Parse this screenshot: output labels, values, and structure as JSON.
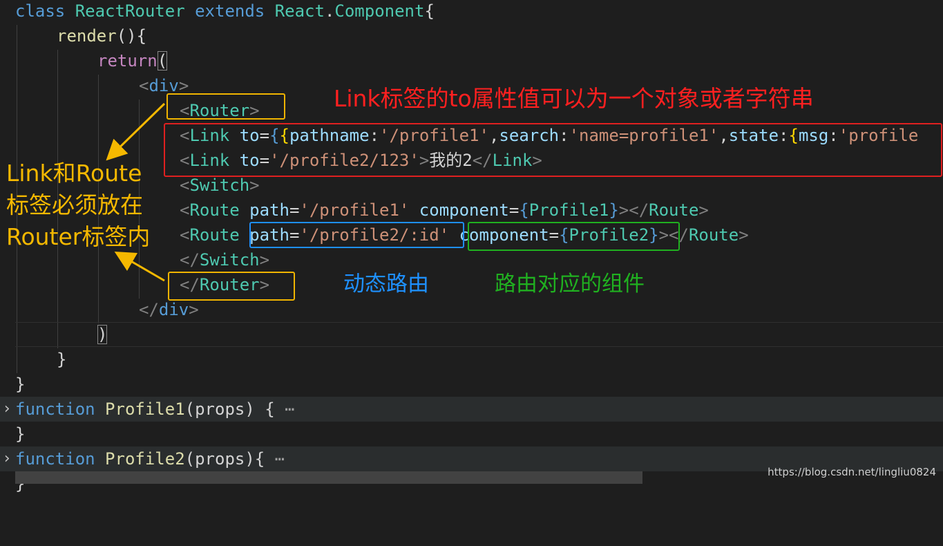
{
  "code_lines": [
    [
      [
        "kw",
        "class "
      ],
      [
        "cls",
        "ReactRouter "
      ],
      [
        "kw",
        "extends "
      ],
      [
        "cls",
        "React"
      ],
      [
        "punc",
        "."
      ],
      [
        "cls",
        "Component"
      ],
      [
        "punc",
        "{"
      ]
    ],
    [
      [
        "fn",
        "render"
      ],
      [
        "punc",
        "(){"
      ]
    ],
    [
      [
        "ret",
        "return"
      ],
      [
        "bracket",
        "("
      ]
    ],
    [
      [
        "br",
        "<"
      ],
      [
        "kw",
        "div"
      ],
      [
        "br",
        ">"
      ]
    ],
    [
      [
        "br",
        "<"
      ],
      [
        "tag",
        "Router"
      ],
      [
        "br",
        ">"
      ]
    ],
    [
      [
        "br",
        "<"
      ],
      [
        "tag",
        "Link "
      ],
      [
        "attr",
        "to"
      ],
      [
        "punc",
        "="
      ],
      [
        "brace1",
        "{"
      ],
      [
        "brace2",
        "{"
      ],
      [
        "attr",
        "pathname"
      ],
      [
        "punc",
        ":"
      ],
      [
        "str",
        "'/profile1'"
      ],
      [
        "punc",
        ","
      ],
      [
        "attr",
        "search"
      ],
      [
        "punc",
        ":"
      ],
      [
        "str",
        "'name=profile1'"
      ],
      [
        "punc",
        ","
      ],
      [
        "attr",
        "state"
      ],
      [
        "punc",
        ":"
      ],
      [
        "brace2",
        "{"
      ],
      [
        "attr",
        "msg"
      ],
      [
        "punc",
        ":"
      ],
      [
        "str",
        "'profile"
      ]
    ],
    [
      [
        "br",
        "<"
      ],
      [
        "tag",
        "Link "
      ],
      [
        "attr",
        "to"
      ],
      [
        "punc",
        "="
      ],
      [
        "str",
        "'/profile2/123'"
      ],
      [
        "br",
        ">"
      ],
      [
        "plain",
        "我的2"
      ],
      [
        "br",
        "</"
      ],
      [
        "tag",
        "Link"
      ],
      [
        "br",
        ">"
      ]
    ],
    [
      [
        "br",
        "<"
      ],
      [
        "tag",
        "Switch"
      ],
      [
        "br",
        ">"
      ]
    ],
    [
      [
        "br",
        "<"
      ],
      [
        "tag",
        "Route "
      ],
      [
        "attr",
        "path"
      ],
      [
        "punc",
        "="
      ],
      [
        "str",
        "'/profile1' "
      ],
      [
        "attr",
        "component"
      ],
      [
        "punc",
        "="
      ],
      [
        "brace1",
        "{"
      ],
      [
        "cls",
        "Profile1"
      ],
      [
        "brace1",
        "}"
      ],
      [
        "br",
        "></"
      ],
      [
        "tag",
        "Route"
      ],
      [
        "br",
        ">"
      ]
    ],
    [
      [
        "br",
        "<"
      ],
      [
        "tag",
        "Route "
      ],
      [
        "attr",
        "path"
      ],
      [
        "punc",
        "="
      ],
      [
        "str",
        "'/profile2/:id' "
      ],
      [
        "attr",
        "component"
      ],
      [
        "punc",
        "="
      ],
      [
        "brace1",
        "{"
      ],
      [
        "cls",
        "Profile2"
      ],
      [
        "brace1",
        "}"
      ],
      [
        "br",
        "></"
      ],
      [
        "tag",
        "Route"
      ],
      [
        "br",
        ">"
      ]
    ],
    [
      [
        "br",
        "</"
      ],
      [
        "tag",
        "Switch"
      ],
      [
        "br",
        ">"
      ]
    ],
    [
      [
        "br",
        "</"
      ],
      [
        "tag",
        "Router"
      ],
      [
        "br",
        ">"
      ]
    ],
    [
      [
        "br",
        "</"
      ],
      [
        "kw",
        "div"
      ],
      [
        "br",
        ">"
      ]
    ],
    [
      [
        "bracket",
        ")"
      ]
    ],
    [
      [
        "punc",
        "}"
      ]
    ],
    [
      [
        "punc",
        "}"
      ]
    ],
    [
      [
        "kw",
        "function "
      ],
      [
        "fn",
        "Profile1"
      ],
      [
        "punc",
        "(props) {"
      ],
      [
        "dots",
        " ⋯"
      ]
    ],
    [
      [
        "punc",
        "}"
      ]
    ],
    [
      [
        "kw",
        "function "
      ],
      [
        "fn",
        "Profile2"
      ],
      [
        "punc",
        "(props){"
      ],
      [
        "dots",
        " ⋯"
      ]
    ],
    [
      [
        "punc",
        "}"
      ]
    ]
  ],
  "annotations": {
    "red_note": "Link标签的to属性值可以为一个对象或者字符串",
    "yellow_note_line1": "Link和Route",
    "yellow_note_line2": "标签必须放在",
    "yellow_note_line3": "Router标签内",
    "blue_note": "动态路由",
    "green_note": "路由对应的组件"
  },
  "watermark": "https://blog.csdn.net/lingliu0824",
  "colors": {
    "background": "#1e1e1e",
    "keyword": "#569cd6",
    "component": "#4ec9b0",
    "string": "#ce9178",
    "attribute": "#9cdcfe",
    "function": "#dcdcaa",
    "return": "#c586c0",
    "annotation_red": "#ff2020",
    "annotation_yellow": "#f5b800",
    "annotation_blue": "#1e90ff",
    "annotation_green": "#20b020"
  }
}
